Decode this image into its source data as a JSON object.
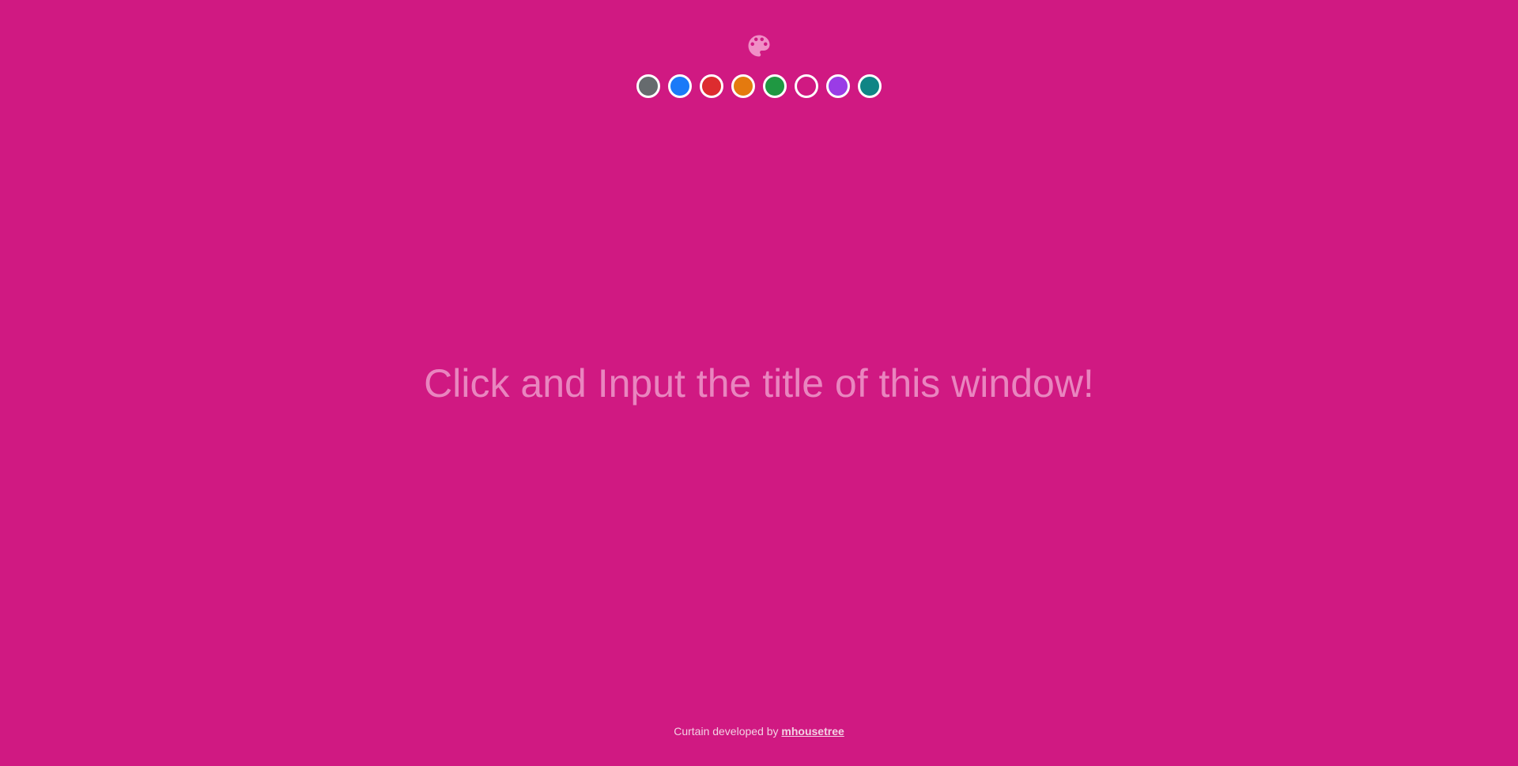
{
  "header": {
    "icon": "palette-icon",
    "icon_color": "#f08fc6"
  },
  "color_swatches": [
    {
      "name": "gray",
      "color": "#666b6e"
    },
    {
      "name": "blue",
      "color": "#1a7af8"
    },
    {
      "name": "red",
      "color": "#dd2c2f"
    },
    {
      "name": "orange",
      "color": "#e47a0f"
    },
    {
      "name": "green",
      "color": "#1f9842"
    },
    {
      "name": "pink",
      "color": "#d01982",
      "selected": true
    },
    {
      "name": "purple",
      "color": "#9a3ce6"
    },
    {
      "name": "teal",
      "color": "#0f8585"
    }
  ],
  "title_input": {
    "placeholder": "Click and Input the title of this window!",
    "value": ""
  },
  "footer": {
    "prefix": "Curtain developed by ",
    "author_link": "mhousetree"
  },
  "theme": {
    "background": "#d01982"
  }
}
